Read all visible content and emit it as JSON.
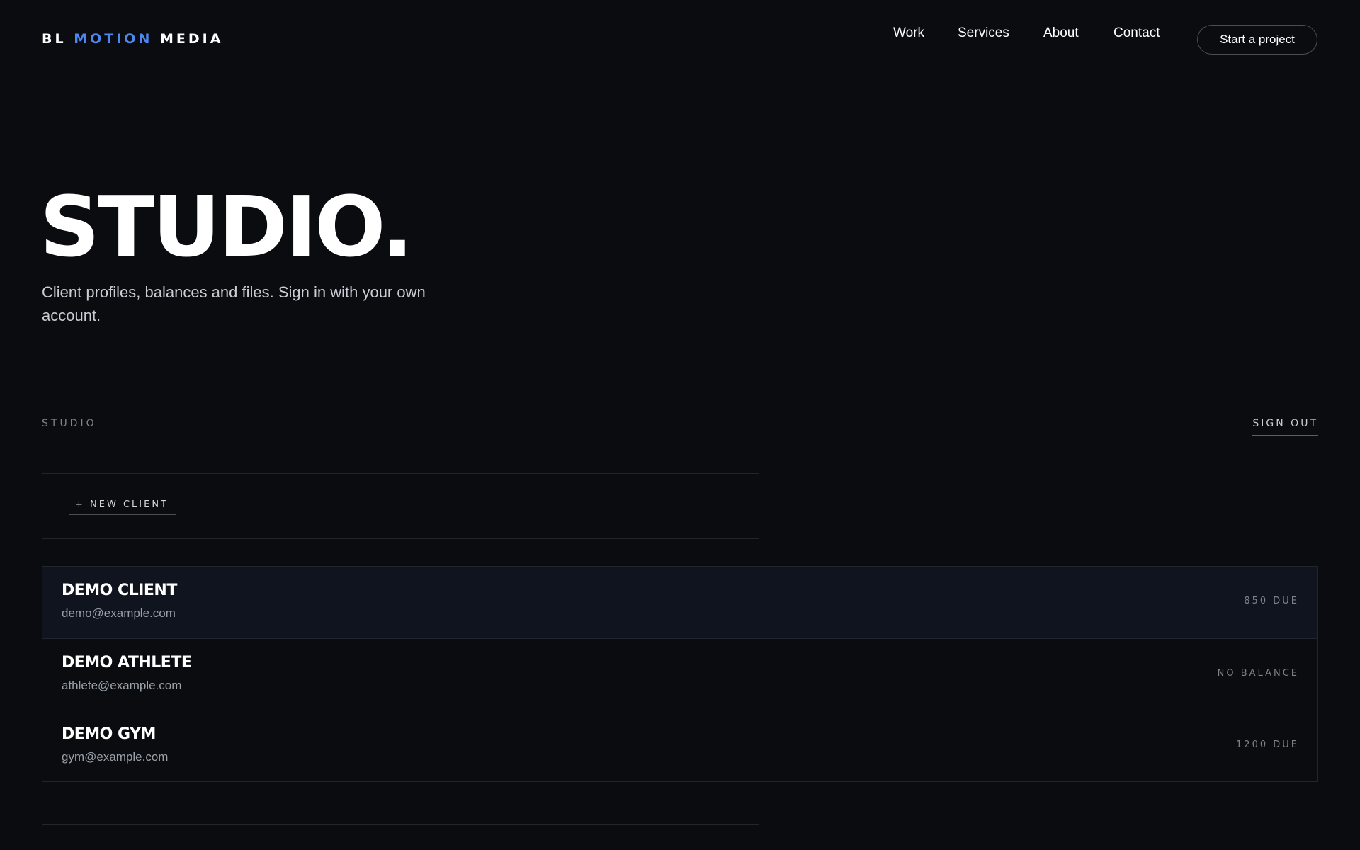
{
  "brand": {
    "part1": "BL",
    "part2": "MOTION",
    "part3": "MEDIA",
    "accent_color": "#4d88f0"
  },
  "nav": {
    "items": [
      {
        "label": "Work"
      },
      {
        "label": "Services"
      },
      {
        "label": "About"
      },
      {
        "label": "Contact"
      }
    ],
    "cta_label": "Start a project"
  },
  "hero": {
    "title": "STUDIO.",
    "subtitle": "Client profiles, balances and files. Sign in with your own account."
  },
  "section": {
    "label": "STUDIO",
    "sign_out_label": "SIGN OUT"
  },
  "new_client": {
    "label": "+ NEW CLIENT"
  },
  "clients": [
    {
      "name": "DEMO CLIENT",
      "email": "demo@example.com",
      "balance": "850 DUE",
      "selected": true
    },
    {
      "name": "DEMO ATHLETE",
      "email": "athlete@example.com",
      "balance": "NO BALANCE",
      "selected": false
    },
    {
      "name": "DEMO GYM",
      "email": "gym@example.com",
      "balance": "1200 DUE",
      "selected": false
    }
  ],
  "colors": {
    "background": "#0a0c0f",
    "selected_row": "#0f141e",
    "border": "#22262c"
  }
}
